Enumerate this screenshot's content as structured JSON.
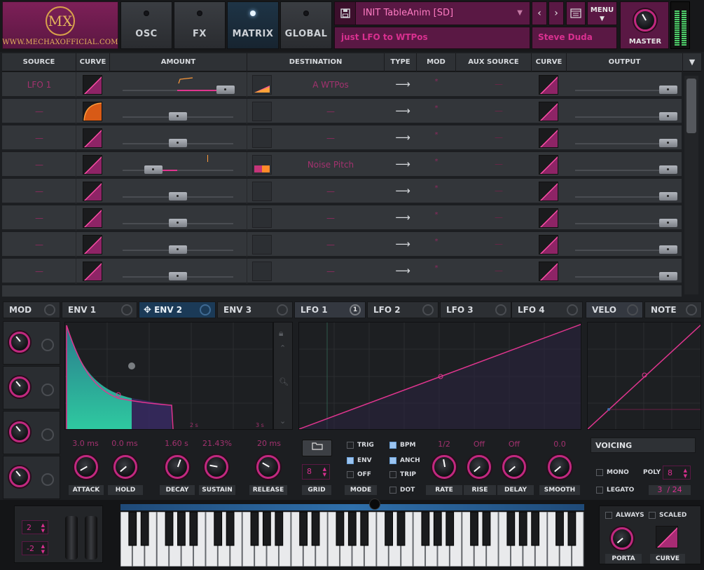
{
  "header": {
    "logo_text": "WWW.MECHAXOFFICIAL.COM",
    "logo_monogram": "MX",
    "tabs": [
      {
        "label": "OSC",
        "active": false
      },
      {
        "label": "FX",
        "active": false
      },
      {
        "label": "MATRIX",
        "active": true
      },
      {
        "label": "GLOBAL",
        "active": false
      }
    ],
    "preset_name": "INIT TableAnim [SD]",
    "preset_description": "just LFO to WTPos",
    "author": "Steve Duda",
    "menu_label": "MENU",
    "master_label": "MASTER"
  },
  "matrix": {
    "columns": [
      "SOURCE",
      "CURVE",
      "AMOUNT",
      "DESTINATION",
      "TYPE",
      "MOD",
      "AUX SOURCE",
      "CURVE",
      "OUTPUT"
    ],
    "rows": [
      {
        "source": "LFO 1",
        "destination": "A WTPos",
        "mod": "*",
        "aux": "—",
        "amount": 0.93
      },
      {
        "source": "—",
        "destination": "—",
        "mod": "*",
        "aux": "—",
        "amount": 0.5
      },
      {
        "source": "—",
        "destination": "—",
        "mod": "*",
        "aux": "—",
        "amount": 0.5
      },
      {
        "source": "—",
        "destination": "Noise Pitch",
        "mod": "*",
        "aux": "—",
        "amount": 0.28
      },
      {
        "source": "—",
        "destination": "—",
        "mod": "*",
        "aux": "—",
        "amount": 0.5
      },
      {
        "source": "—",
        "destination": "—",
        "mod": "*",
        "aux": "—",
        "amount": 0.5
      },
      {
        "source": "—",
        "destination": "—",
        "mod": "*",
        "aux": "—",
        "amount": 0.5
      },
      {
        "source": "—",
        "destination": "—",
        "mod": "*",
        "aux": "—",
        "amount": 0.5
      }
    ],
    "type_symbol": "⟶"
  },
  "bottom_tabs": {
    "mod": "MOD",
    "env1": "ENV 1",
    "env2": "ENV 2",
    "env3": "ENV 3",
    "lfo1": "LFO 1",
    "lfo1_count": "1",
    "lfo2": "LFO 2",
    "lfo3": "LFO 3",
    "lfo4": "LFO 4",
    "velo": "VELO",
    "note": "NOTE"
  },
  "env": {
    "time_marks": [
      "2 s",
      "3 s"
    ],
    "values": {
      "attack": "3.0 ms",
      "hold": "0.0 ms",
      "decay": "1.60 s",
      "sustain": "21.43%",
      "release": "20 ms"
    },
    "labels": {
      "attack": "ATTACK",
      "hold": "HOLD",
      "decay": "DECAY",
      "sustain": "SUSTAIN",
      "release": "RELEASE"
    }
  },
  "lfo": {
    "grid_label": "GRID",
    "grid_value": "8",
    "mode_label": "MODE",
    "mode_options": {
      "trig": "TRIG",
      "env": "ENV",
      "off": "OFF"
    },
    "flags": {
      "bpm": "BPM",
      "anch": "ANCH",
      "trip": "TRIP",
      "dot": "DOT"
    },
    "values": {
      "rate": "1/2",
      "rise": "Off",
      "delay": "Off",
      "smooth": "0.0"
    },
    "labels": {
      "rate": "RATE",
      "rise": "RISE",
      "delay": "DELAY",
      "smooth": "SMOOTH"
    }
  },
  "voicing": {
    "title": "VOICING",
    "mono": "MONO",
    "legato": "LEGATO",
    "poly_label": "POLY",
    "poly_value": "8",
    "voices": "3  / 24"
  },
  "keyboard": {
    "pitch_up": "2",
    "pitch_down": "-2",
    "always": "ALWAYS",
    "scaled": "SCALED",
    "porta": "PORTA",
    "curve": "CURVE"
  },
  "colors": {
    "accent": "#d8308f",
    "active_tab": "#1b3a57",
    "meter": "#4fd16b"
  }
}
